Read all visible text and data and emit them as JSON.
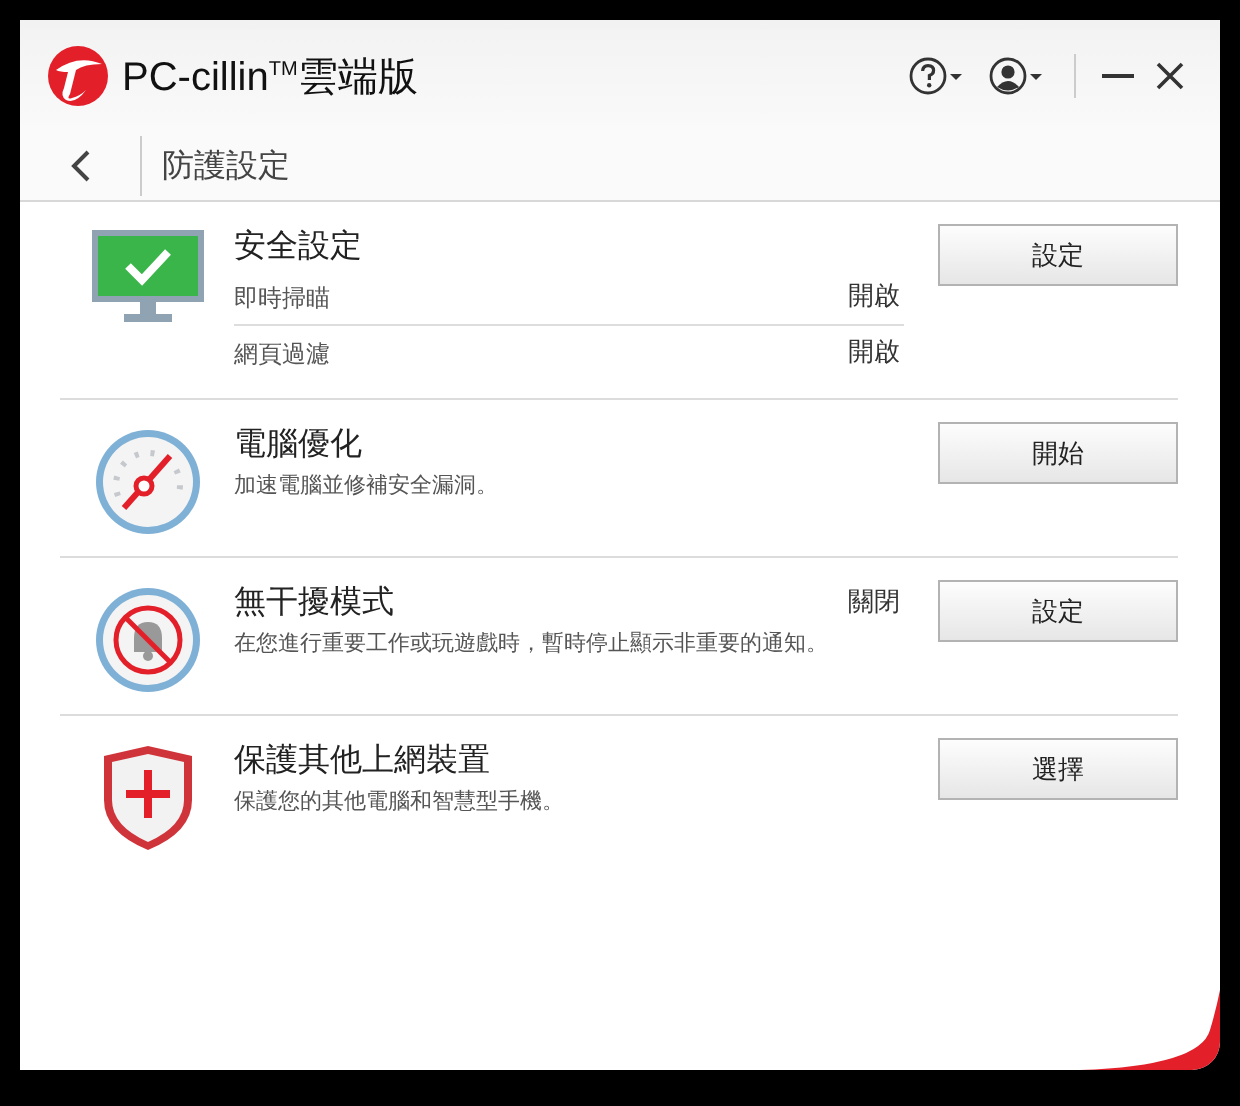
{
  "window": {
    "title": "PC-cillin$^{TM}$雲端版"
  },
  "page": {
    "title": "防護設定"
  },
  "sections": [
    {
      "kind": "settings",
      "title": "安全設定",
      "settings": [
        {
          "label": "即時掃瞄",
          "value": "開啟"
        },
        {
          "label": "網頁過濾",
          "value": "開啟"
        }
      ],
      "button": "設定"
    },
    {
      "kind": "description",
      "title": "電腦優化",
      "description": "加速電腦並修補安全漏洞。",
      "button": "開始"
    },
    {
      "kind": "description",
      "title": "無干擾模式",
      "status": "關閉",
      "description": "在您進行重要工作或玩遊戲時，暫時停止顯示非重要的通知。",
      "button": "設定"
    },
    {
      "kind": "description",
      "title": "保護其他上網裝置",
      "description": "保護您的其他電腦和智慧型手機。",
      "button": "選擇"
    }
  ]
}
